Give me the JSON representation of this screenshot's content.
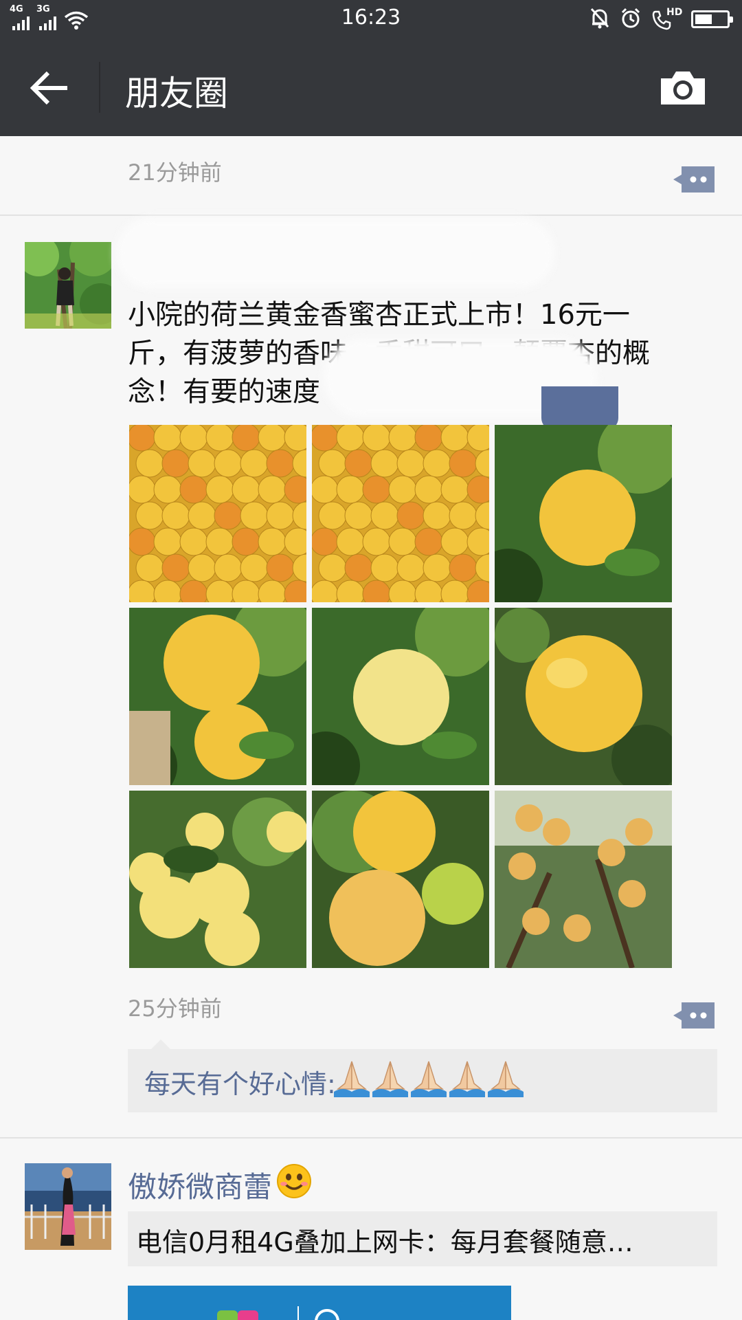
{
  "status_bar": {
    "network1": "4G",
    "network2": "3G",
    "time": "16:23",
    "volte": "HD",
    "battery_level": 0.55,
    "icons": [
      "signal-icon",
      "signal-icon",
      "wifi-icon",
      "bell-off-icon",
      "alarm-icon",
      "call-hd-icon",
      "battery-icon"
    ]
  },
  "header": {
    "title": "朋友圈",
    "back_icon": "arrow-left-icon",
    "camera_icon": "camera-icon"
  },
  "feed": {
    "first_item_time": "21分钟前",
    "posts": [
      {
        "text": "小院的荷兰黄金香蜜杏正式上市！16元一斤，有菠萝的香味，香甜可口，颠覆杏的概念！有要的速度",
        "text_lines": [
          "小院的荷兰黄金香蜜杏正式上市！16元一",
          "斤，有菠萝的香味，香甜可口，颠覆杏的概",
          "念！有要的速度"
        ],
        "photo_count": 9,
        "time": "25分钟前",
        "likes": "每天有个好心情:",
        "like_emoji_count": 5
      },
      {
        "name": "傲娇微商蕾",
        "name_emoji": "😊",
        "shared_text": "电信0月租4G叠加上网卡：每月套餐随意…"
      }
    ]
  },
  "colors": {
    "header_bg": "#35373b",
    "link_blue": "#576b95",
    "apricot": "#f2c43c"
  }
}
